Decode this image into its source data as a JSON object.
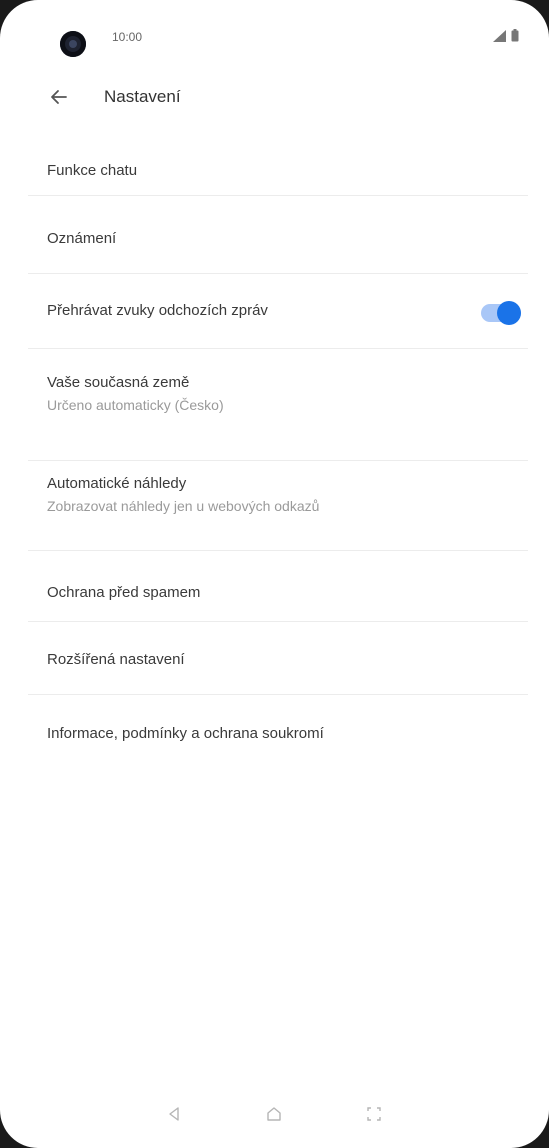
{
  "status_bar": {
    "time": "10:00",
    "icons": [
      "signal-icon",
      "battery-icon"
    ]
  },
  "appbar": {
    "back_icon": "arrow-left-icon",
    "title": "Nastavení"
  },
  "settings": {
    "chat_features": {
      "title": "Funkce chatu"
    },
    "notifications": {
      "title": "Oznámení"
    },
    "outgoing_sounds": {
      "title": "Přehrávat zvuky odchozích zpráv",
      "enabled": true
    },
    "country": {
      "title": "Vaše současná země",
      "subtitle": "Určeno automaticky (Česko)"
    },
    "auto_previews": {
      "title": "Automatické náhledy",
      "subtitle": "Zobrazovat náhledy jen u webových odkazů"
    },
    "spam_protection": {
      "title": "Ochrana před spamem"
    },
    "advanced": {
      "title": "Rozšířená nastavení"
    },
    "about": {
      "title": "Informace, podmínky a ochrana soukromí"
    }
  },
  "nav_bar": {
    "back": "triangle-back-icon",
    "home": "home-icon",
    "recents": "recents-icon"
  },
  "colors": {
    "accent": "#1a73e8",
    "toggle_track": "#a9c7f7",
    "title_text": "#3a3a3a",
    "subtitle_text": "#9a9a9a",
    "divider": "#ececec"
  }
}
